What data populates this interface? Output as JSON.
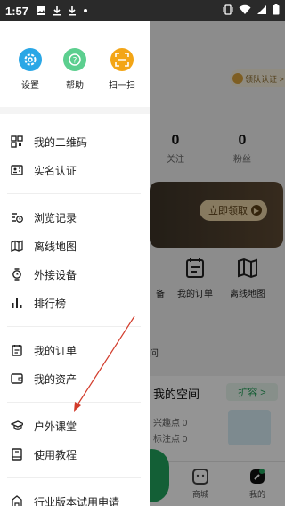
{
  "status_bar": {
    "time": "1:57",
    "colors": {
      "bg": "#2a2a2a"
    }
  },
  "drawer": {
    "quick_actions": [
      {
        "label": "设置",
        "icon": "gear-icon",
        "color": "#2aa7e6"
      },
      {
        "label": "帮助",
        "icon": "help-icon",
        "color": "#5ccf8f"
      },
      {
        "label": "扫一扫",
        "icon": "scan-icon",
        "color": "#f3a516"
      }
    ],
    "groups": [
      [
        {
          "label": "我的二维码",
          "icon": "qr-code-icon"
        },
        {
          "label": "实名认证",
          "icon": "id-card-icon"
        }
      ],
      [
        {
          "label": "浏览记录",
          "icon": "history-icon"
        },
        {
          "label": "离线地图",
          "icon": "offline-map-icon"
        },
        {
          "label": "外接设备",
          "icon": "watch-icon"
        },
        {
          "label": "排行榜",
          "icon": "bar-chart-icon"
        }
      ],
      [
        {
          "label": "我的订单",
          "icon": "order-icon"
        },
        {
          "label": "我的资产",
          "icon": "wallet-icon"
        }
      ],
      [
        {
          "label": "户外课堂",
          "icon": "graduation-cap-icon"
        },
        {
          "label": "使用教程",
          "icon": "book-icon"
        }
      ],
      [
        {
          "label": "行业版本试用申请",
          "icon": "trial-icon"
        }
      ]
    ]
  },
  "background": {
    "cert_badge": "领队认证 >",
    "stats": [
      {
        "value": "0",
        "label": "关注"
      },
      {
        "value": "0",
        "label": "粉丝"
      }
    ],
    "promo": {
      "button": "立即领取"
    },
    "tiles": [
      {
        "label": "备",
        "icon": "equipment-icon"
      },
      {
        "label": "我的订单",
        "icon": "order-icon"
      },
      {
        "label": "离线地图",
        "icon": "offline-map-icon"
      }
    ],
    "fragment_label": "问",
    "space": {
      "title": "我的空间",
      "expand": "扩容 >",
      "lines": [
        "兴趣点 0",
        "标注点 0"
      ]
    },
    "nav": [
      {
        "label": "商城",
        "icon": "shop-icon"
      },
      {
        "label": "我的",
        "icon": "profile-icon"
      }
    ]
  },
  "colors": {
    "accent_green": "#1f9d55",
    "annotation_red": "#d23b2b"
  }
}
